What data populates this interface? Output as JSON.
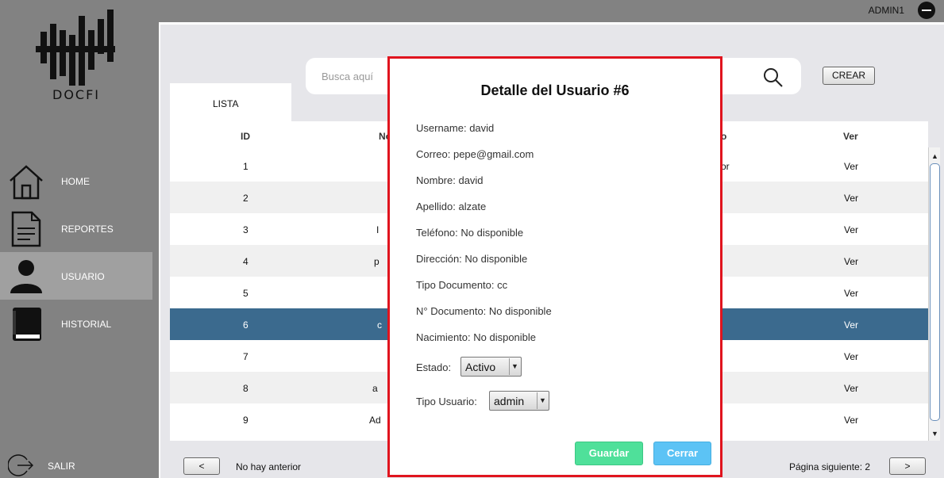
{
  "header": {
    "user": "ADMIN1"
  },
  "logo": {
    "text": "DOCFI"
  },
  "sidebar": {
    "items": [
      {
        "label": "HOME",
        "icon": "home-icon"
      },
      {
        "label": "REPORTES",
        "icon": "document-icon"
      },
      {
        "label": "USUARIO",
        "icon": "user-icon",
        "active": true
      },
      {
        "label": "HISTORIAL",
        "icon": "book-icon"
      }
    ],
    "logout": {
      "label": "SALIR",
      "icon": "logout-icon"
    }
  },
  "search": {
    "placeholder": "Busca aquí"
  },
  "toolbar": {
    "crear_label": "CREAR"
  },
  "tabs": {
    "lista": "LISTA"
  },
  "table": {
    "headers": {
      "id": "ID",
      "nombre_partial": "No",
      "estado_partial": "o",
      "ver": "Ver"
    },
    "rows": [
      {
        "id": "1",
        "name_partial": "",
        "state_partial": "or",
        "ver": "Ver"
      },
      {
        "id": "2",
        "name_partial": "",
        "state_partial": "",
        "ver": "Ver"
      },
      {
        "id": "3",
        "name_partial": "I",
        "state_partial": "",
        "ver": "Ver"
      },
      {
        "id": "4",
        "name_partial": "p",
        "state_partial": "",
        "ver": "Ver"
      },
      {
        "id": "5",
        "name_partial": "",
        "state_partial": "",
        "ver": "Ver"
      },
      {
        "id": "6",
        "name_partial": "c",
        "state_partial": "",
        "ver": "Ver",
        "selected": true
      },
      {
        "id": "7",
        "name_partial": "",
        "state_partial": "",
        "ver": "Ver"
      },
      {
        "id": "8",
        "name_partial": "a",
        "state_partial": "",
        "ver": "Ver"
      },
      {
        "id": "9",
        "name_partial": "Ad",
        "state_partial": "",
        "ver": "Ver"
      }
    ]
  },
  "pagination": {
    "prev_label": "<",
    "prev_text": "No hay anterior",
    "next_text": "Página siguiente: 2",
    "next_label": ">"
  },
  "modal": {
    "title": "Detalle del Usuario #6",
    "fields": {
      "username": "Username: david",
      "correo": "Correo: pepe@gmail.com",
      "nombre": "Nombre: david",
      "apellido": "Apellido: alzate",
      "telefono": "Teléfono: No disponible",
      "direccion": "Dirección: No disponible",
      "tipo_documento": "Tipo Documento: cc",
      "numero_documento": "N° Documento: No disponible",
      "nacimiento": "Nacimiento: No disponible"
    },
    "estado": {
      "label": "Estado:",
      "value": "Activo"
    },
    "tipo_usuario": {
      "label": "Tipo Usuario:",
      "value": "admin"
    },
    "guardar_label": "Guardar",
    "cerrar_label": "Cerrar"
  },
  "colors": {
    "selected_row": "#3b6a8e",
    "modal_border": "#e0141e",
    "guardar": "#4fe09a",
    "cerrar": "#5cc3f5"
  }
}
